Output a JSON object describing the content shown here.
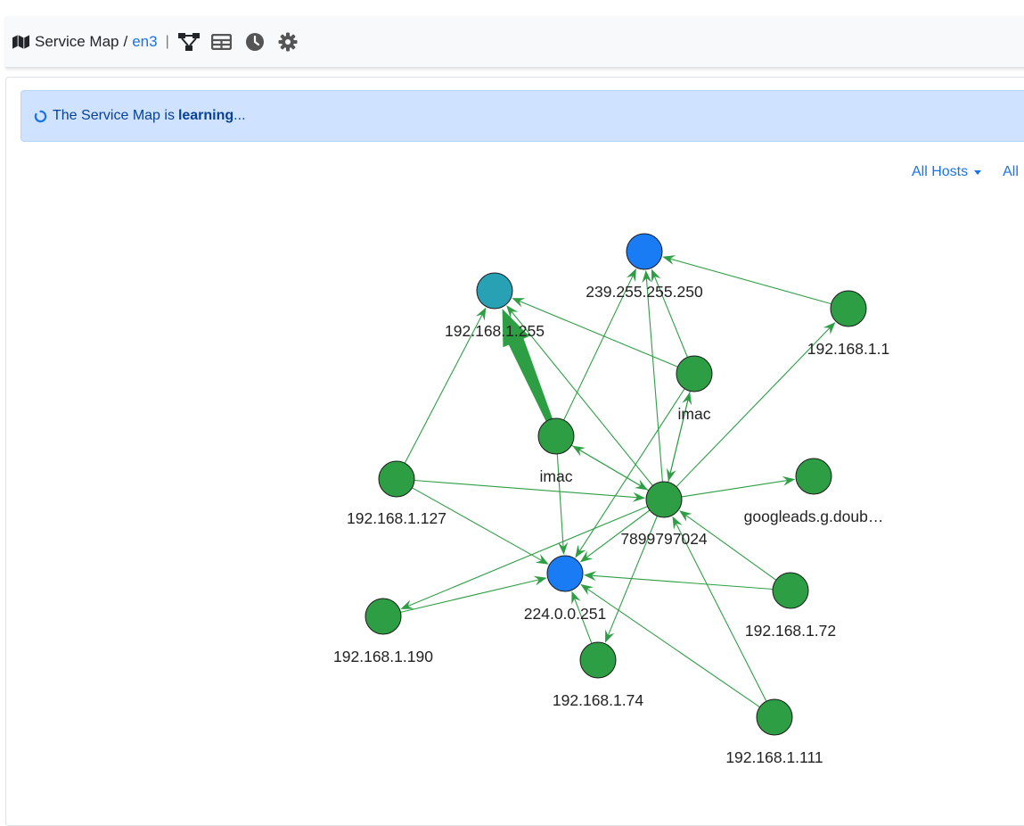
{
  "header": {
    "title": "Service Map",
    "separator": "/",
    "interface": "en3",
    "divider": "|",
    "icons": [
      "map-icon",
      "topology-icon",
      "table-icon",
      "clock-icon",
      "gear-icon"
    ]
  },
  "alert": {
    "prefix": "The Service Map is",
    "status": "learning",
    "suffix": "..."
  },
  "filters": {
    "hosts": "All Hosts",
    "second": "All"
  },
  "colors": {
    "local_node": "#2e9e45",
    "multicast_node": "#1a7cf5",
    "broadcast_node": "#27a1b3",
    "edge": "#2e9e45",
    "link": "#1a73e8",
    "alert_bg": "#cfe2ff"
  },
  "graph": {
    "nodes": [
      {
        "id": "n239",
        "label": "239.255.255.250",
        "kind": "multicast"
      },
      {
        "id": "n255",
        "label": "192.168.1.255",
        "kind": "broadcast"
      },
      {
        "id": "n1",
        "label": "192.168.1.1",
        "kind": "host"
      },
      {
        "id": "imacR",
        "label": "imac",
        "kind": "host"
      },
      {
        "id": "imacL",
        "label": "imac",
        "kind": "host"
      },
      {
        "id": "n127",
        "label": "192.168.1.127",
        "kind": "host"
      },
      {
        "id": "n789",
        "label": "7899797024",
        "kind": "host"
      },
      {
        "id": "ngoo",
        "label": "googleads.g.doub…",
        "kind": "host"
      },
      {
        "id": "n224",
        "label": "224.0.0.251",
        "kind": "multicast"
      },
      {
        "id": "n190",
        "label": "192.168.1.190",
        "kind": "host"
      },
      {
        "id": "n72",
        "label": "192.168.1.72",
        "kind": "host"
      },
      {
        "id": "n74",
        "label": "192.168.1.74",
        "kind": "host"
      },
      {
        "id": "n111",
        "label": "192.168.1.111",
        "kind": "host"
      }
    ],
    "edges": [
      {
        "from": "imacL",
        "to": "n255",
        "heavy": true
      },
      {
        "from": "n127",
        "to": "n255"
      },
      {
        "from": "imacR",
        "to": "n255"
      },
      {
        "from": "n789",
        "to": "n255"
      },
      {
        "from": "imacL",
        "to": "n239"
      },
      {
        "from": "imacR",
        "to": "n239"
      },
      {
        "from": "n789",
        "to": "n239"
      },
      {
        "from": "n1",
        "to": "n239"
      },
      {
        "from": "n789",
        "to": "n1"
      },
      {
        "from": "n789",
        "to": "imacR"
      },
      {
        "from": "imacR",
        "to": "n789"
      },
      {
        "from": "n789",
        "to": "imacL"
      },
      {
        "from": "imacL",
        "to": "n789"
      },
      {
        "from": "n127",
        "to": "n789"
      },
      {
        "from": "n789",
        "to": "ngoo"
      },
      {
        "from": "n127",
        "to": "n224"
      },
      {
        "from": "imacL",
        "to": "n224"
      },
      {
        "from": "imacR",
        "to": "n224"
      },
      {
        "from": "n789",
        "to": "n224"
      },
      {
        "from": "n190",
        "to": "n224"
      },
      {
        "from": "n789",
        "to": "n190"
      },
      {
        "from": "n72",
        "to": "n224"
      },
      {
        "from": "n74",
        "to": "n224"
      },
      {
        "from": "n111",
        "to": "n224"
      },
      {
        "from": "n72",
        "to": "n789"
      },
      {
        "from": "n111",
        "to": "n789"
      },
      {
        "from": "n789",
        "to": "n74"
      }
    ]
  }
}
